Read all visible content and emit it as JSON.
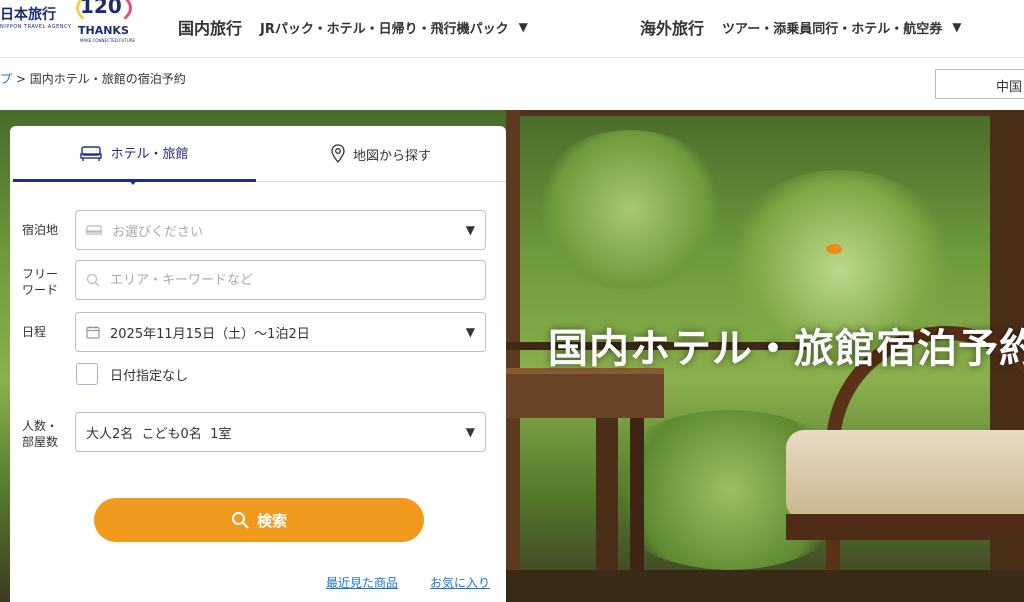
{
  "header": {
    "logo_text": "日本旅行",
    "logo_sub": "NIPPON TRAVEL AGENCY",
    "anniversary": {
      "number": "120",
      "word": "ANNIVERSARY",
      "thanks": "THANKS",
      "sub": "MAKE CONNECTED FUTURE"
    },
    "nav": [
      {
        "main": "国内旅行",
        "sub": "JRパック・ホテル・日帰り・飛行機パック"
      },
      {
        "main": "海外旅行",
        "sub": "ツアー・添乗員同行・ホテル・航空券"
      }
    ]
  },
  "breadcrumb": {
    "prev": "プ",
    "separator": ">",
    "current": "国内ホテル・旅館の宿泊予約"
  },
  "language_button": "中国",
  "hero": {
    "title": "国内ホテル・旅館宿泊予約"
  },
  "search_panel": {
    "tabs": [
      {
        "label": "ホテル・旅館",
        "icon": "bed-icon",
        "active": true
      },
      {
        "label": "地図から探す",
        "icon": "map-pin-icon",
        "active": false
      }
    ],
    "destination": {
      "label": "宿泊地",
      "placeholder": "お選びください"
    },
    "freeword": {
      "label_line1": "フリー",
      "label_line2": "ワード",
      "placeholder": "エリア・キーワードなど"
    },
    "date": {
      "label": "日程",
      "value": "2025年11月15日（土）〜1泊2日"
    },
    "no_date": {
      "label": "日付指定なし",
      "checked": false
    },
    "guests": {
      "label_line1": "人数・",
      "label_line2": "部屋数",
      "value": "大人2名  こども0名  1室"
    },
    "search_button": "検索",
    "links": {
      "recent": "最近見た商品",
      "favorites": "お気に入り"
    }
  },
  "colors": {
    "accent_navy": "#1f2d8a",
    "button_orange": "#f19a1d",
    "link_blue": "#1976d2"
  }
}
